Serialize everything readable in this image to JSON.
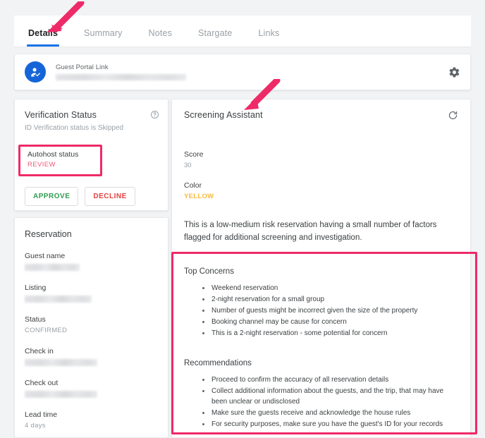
{
  "tabs": [
    {
      "label": "Details",
      "active": true
    },
    {
      "label": "Summary",
      "active": false
    },
    {
      "label": "Notes",
      "active": false
    },
    {
      "label": "Stargate",
      "active": false
    },
    {
      "label": "Links",
      "active": false
    }
  ],
  "portal": {
    "title": "Guest Portal Link",
    "link_redacted": true,
    "avatar_icon": "person-check-icon",
    "settings_icon": "gear-icon"
  },
  "verification": {
    "title": "Verification Status",
    "help_icon": "help-circle-icon",
    "subtitle": "ID Verification status is Skipped",
    "autohost_label": "Autohost status",
    "autohost_value": "REVIEW",
    "approve_label": "APPROVE",
    "decline_label": "DECLINE"
  },
  "reservation": {
    "title": "Reservation",
    "fields": [
      {
        "label": "Guest name",
        "value": "",
        "redacted": true
      },
      {
        "label": "Listing",
        "value": "",
        "redacted": true
      },
      {
        "label": "Status",
        "value": "CONFIRMED",
        "redacted": false
      },
      {
        "label": "Check in",
        "value": "",
        "redacted": true
      },
      {
        "label": "Check out",
        "value": "",
        "redacted": true
      },
      {
        "label": "Lead time",
        "value": "4 days",
        "redacted": false
      }
    ]
  },
  "screening": {
    "title": "Screening Assistant",
    "refresh_icon": "refresh-icon",
    "score_label": "Score",
    "score_value": "30",
    "color_label": "Color",
    "color_value": "YELLOW",
    "risk_summary": "This is a low-medium risk reservation having a small number of factors flagged for additional screening and investigation.",
    "concerns_title": "Top Concerns",
    "concerns": [
      "Weekend reservation",
      "2-night reservation for a small group",
      "Number of guests might be incorrect given the size of the property",
      "Booking channel may be cause for concern",
      "This is a 2-night reservation - some potential for concern"
    ],
    "recommendations_title": "Recommendations",
    "recommendations": [
      "Proceed to confirm the accuracy of all reservation details",
      "Collect additional information about the guests, and the trip, that may have been unclear or undisclosed",
      "Make sure the guests receive and acknowledge the house rules",
      "For security purposes, make sure you have the guest's ID for your records"
    ]
  },
  "colors": {
    "annotation": "#ee2a68",
    "tab_active_underline": "#1a73e8",
    "approve": "#2e9e51",
    "decline": "#e5413f",
    "review": "#ef5a7a",
    "yellow": "#f5bb3d",
    "avatar": "#1565d8"
  }
}
